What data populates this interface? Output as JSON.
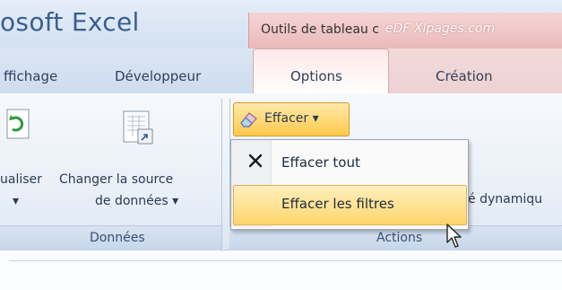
{
  "window": {
    "app_title": "osoft Excel",
    "context_group_label": "Outils de tableau c",
    "watermark": "eDF Xlpages.com"
  },
  "tabs": [
    {
      "label": "ffichage"
    },
    {
      "label": "Développeur"
    },
    {
      "label": "Options"
    },
    {
      "label": "Création"
    }
  ],
  "groups": {
    "donnees": {
      "label": "Données",
      "buttons": [
        {
          "label": "ualiser"
        },
        {
          "label_line1": "Changer la source",
          "label_line2": "de données ▾"
        }
      ]
    },
    "actions": {
      "label": "Actions",
      "effacer_label": "Effacer ▾",
      "side_text": "é dynamiqu"
    }
  },
  "dropdown_menu": {
    "items": [
      {
        "label": "Effacer tout"
      },
      {
        "label": "Effacer les filtres"
      }
    ]
  },
  "icons": {
    "refresh": "refresh-data-icon",
    "change_source": "change-data-source-icon",
    "eraser": "eraser-icon",
    "clear_all": "x-clear-icon",
    "cursor": "mouse-pointer-icon"
  },
  "colors": {
    "context_tab_red": "#eab9b9",
    "highlight_yellow": "#ffd56b",
    "ribbon_blue": "#dce6f3"
  }
}
